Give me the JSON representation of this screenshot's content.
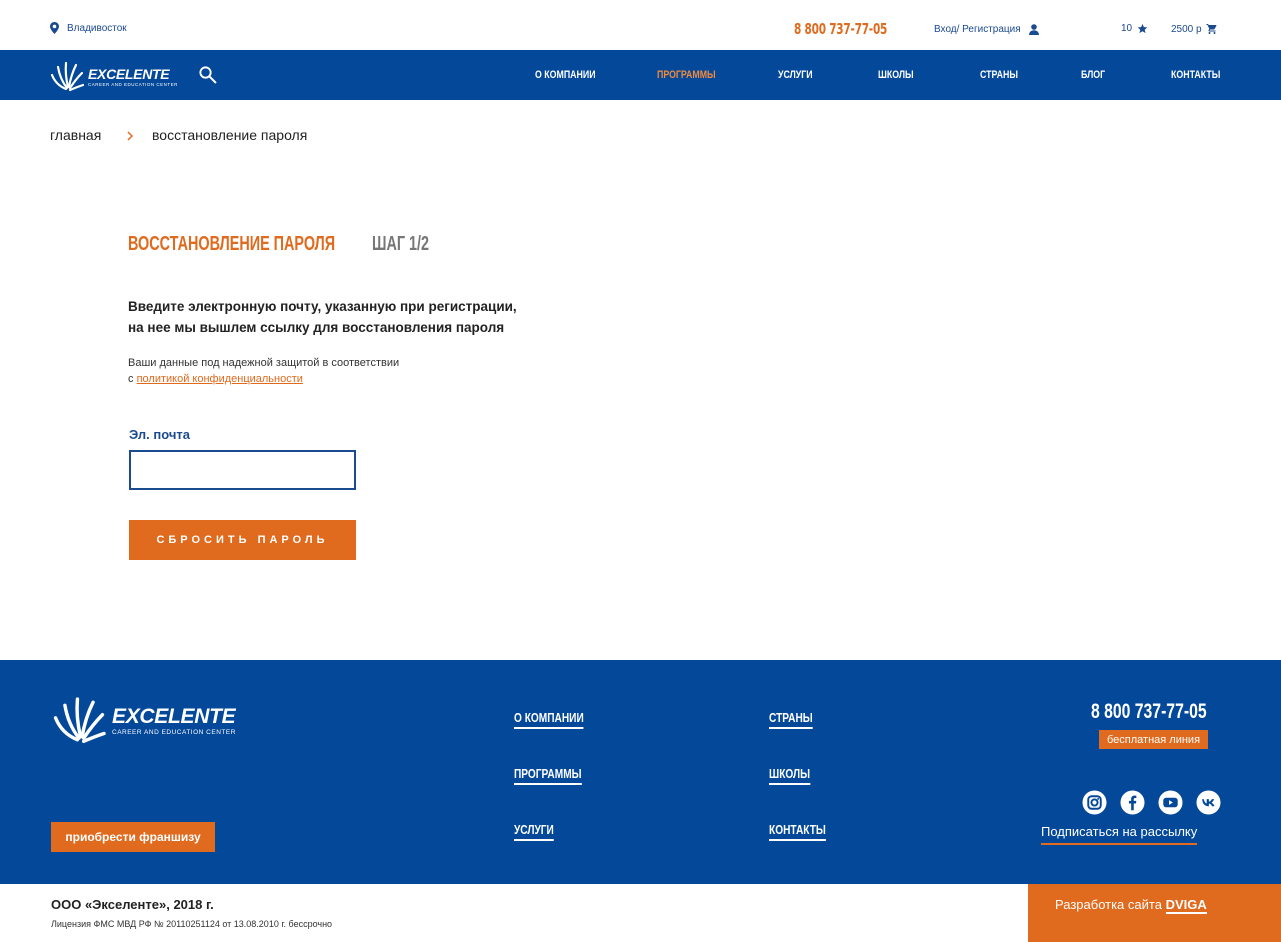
{
  "topbar": {
    "city": "Владивосток",
    "phone": "8 800 737-77-05",
    "login": "Вход/ Регистрация",
    "favorites_count": "10",
    "cart_total": "2500 р"
  },
  "logo": {
    "name": "EXCELENTE",
    "tagline": "CAREER AND EDUCATION CENTER"
  },
  "nav": [
    {
      "label": "О компании",
      "active": false
    },
    {
      "label": "Программы",
      "active": true
    },
    {
      "label": "Услуги",
      "active": false
    },
    {
      "label": "Школы",
      "active": false
    },
    {
      "label": "Страны",
      "active": false
    },
    {
      "label": "Блог",
      "active": false
    },
    {
      "label": "Контакты",
      "active": false
    }
  ],
  "breadcrumb": {
    "home": "главная",
    "current": "восстановление пароля"
  },
  "form": {
    "title": "Восстановление пароля",
    "step": "Шаг 1/2",
    "lead_line1": "Введите электронную почту, указанную при регистрации,",
    "lead_line2": "на нее мы вышлем ссылку для восстановления пароля",
    "note_line1": "Ваши данные под надежной защитой в соответствии",
    "note_prefix": "с ",
    "note_link": "политикой конфиденциальности",
    "email_label": "Эл. почта",
    "email_value": "",
    "email_placeholder": "",
    "submit": "Сбросить пароль"
  },
  "footer": {
    "links_col1": [
      "О компании",
      "Программы",
      "Услуги"
    ],
    "links_col2": [
      "Страны",
      "Школы",
      "Контакты"
    ],
    "franchise": "приобрести франшизу",
    "phone": "8 800 737-77-05",
    "free_line": "бесплатная линия",
    "social_icons": [
      "instagram-icon",
      "facebook-icon",
      "youtube-icon",
      "vk-icon"
    ],
    "subscribe": "Подписаться на рассылку",
    "copyright": "ООО «Экселенте», 2018 г.",
    "license": "Лицензия ФМС МВД РФ № 20110251124 от 13.08.2010 г. бессрочно",
    "dev_prefix": "Разработка сайта",
    "dev_name": "DVIGA"
  },
  "colors": {
    "brand_blue": "#04489a",
    "accent_orange": "#e06a1d"
  }
}
